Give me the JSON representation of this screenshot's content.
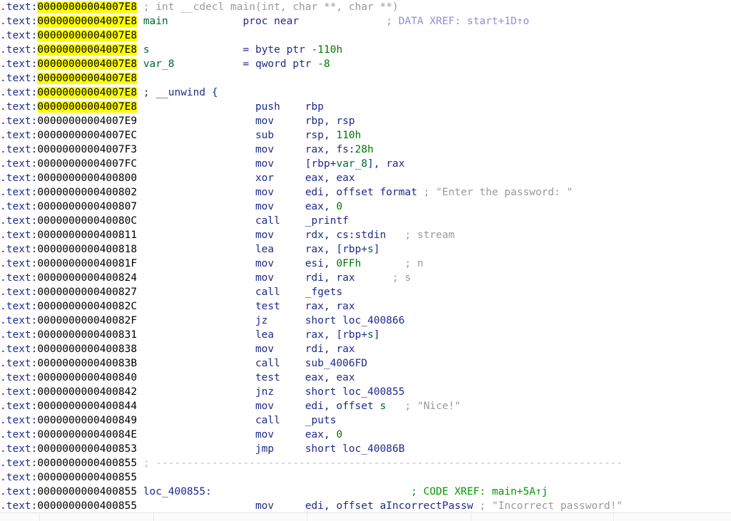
{
  "view": {
    "title": "IDA View-A",
    "segment": ".text",
    "highlight_color": "#ffff00",
    "background_color": "#ffffff"
  },
  "columns": {
    "segment_prefix": ".text:",
    "address_width_chars": 16
  },
  "lines": [
    {
      "seg": ".text:",
      "addr": "00000000004007E8",
      "hl": true,
      "body": [
        {
          "t": "gap",
          "v": " "
        },
        {
          "t": "cmt",
          "v": "; int __cdecl main(int, char **, char **)"
        }
      ]
    },
    {
      "seg": ".text:",
      "addr": "00000000004007E8",
      "hl": true,
      "body": [
        {
          "t": "gap",
          "v": " "
        },
        {
          "t": "name",
          "v": "main"
        },
        {
          "t": "gap",
          "v": "            "
        },
        {
          "t": "kw",
          "v": "proc near"
        },
        {
          "t": "gap",
          "v": "              "
        },
        {
          "t": "xref-d",
          "v": "; DATA XREF: start+1D↑o"
        }
      ]
    },
    {
      "seg": ".text:",
      "addr": "00000000004007E8",
      "hl": true,
      "body": []
    },
    {
      "seg": ".text:",
      "addr": "00000000004007E8",
      "hl": true,
      "body": [
        {
          "t": "gap",
          "v": " "
        },
        {
          "t": "name",
          "v": "s"
        },
        {
          "t": "gap",
          "v": "               "
        },
        {
          "t": "kw",
          "v": "= byte ptr "
        },
        {
          "t": "num",
          "v": "-110h"
        }
      ]
    },
    {
      "seg": ".text:",
      "addr": "00000000004007E8",
      "hl": true,
      "body": [
        {
          "t": "gap",
          "v": " "
        },
        {
          "t": "name",
          "v": "var_8"
        },
        {
          "t": "gap",
          "v": "           "
        },
        {
          "t": "kw",
          "v": "= qword ptr "
        },
        {
          "t": "num",
          "v": "-8"
        }
      ]
    },
    {
      "seg": ".text:",
      "addr": "00000000004007E8",
      "hl": true,
      "body": []
    },
    {
      "seg": ".text:",
      "addr": "00000000004007E8",
      "hl": true,
      "body": [
        {
          "t": "gap",
          "v": " "
        },
        {
          "t": "reg",
          "v": "; __unwind {"
        }
      ]
    },
    {
      "seg": ".text:",
      "addr": "00000000004007E8",
      "hl": true,
      "body": [
        {
          "t": "gap",
          "v": "                   "
        },
        {
          "t": "mnem",
          "v": "push"
        },
        {
          "t": "gap",
          "v": "    "
        },
        {
          "t": "reg",
          "v": "rbp"
        }
      ]
    },
    {
      "seg": ".text:",
      "addr": "00000000004007E9",
      "hl": false,
      "body": [
        {
          "t": "gap",
          "v": "                   "
        },
        {
          "t": "mnem",
          "v": "mov"
        },
        {
          "t": "gap",
          "v": "     "
        },
        {
          "t": "reg",
          "v": "rbp, rsp"
        }
      ]
    },
    {
      "seg": ".text:",
      "addr": "00000000004007EC",
      "hl": false,
      "body": [
        {
          "t": "gap",
          "v": "                   "
        },
        {
          "t": "mnem",
          "v": "sub"
        },
        {
          "t": "gap",
          "v": "     "
        },
        {
          "t": "reg",
          "v": "rsp, "
        },
        {
          "t": "num",
          "v": "110h"
        }
      ]
    },
    {
      "seg": ".text:",
      "addr": "00000000004007F3",
      "hl": false,
      "body": [
        {
          "t": "gap",
          "v": "                   "
        },
        {
          "t": "mnem",
          "v": "mov"
        },
        {
          "t": "gap",
          "v": "     "
        },
        {
          "t": "reg",
          "v": "rax, fs:"
        },
        {
          "t": "num",
          "v": "28h"
        }
      ]
    },
    {
      "seg": ".text:",
      "addr": "00000000004007FC",
      "hl": false,
      "body": [
        {
          "t": "gap",
          "v": "                   "
        },
        {
          "t": "mnem",
          "v": "mov"
        },
        {
          "t": "gap",
          "v": "     "
        },
        {
          "t": "reg",
          "v": "[rbp+"
        },
        {
          "t": "name",
          "v": "var_8"
        },
        {
          "t": "reg",
          "v": "], rax"
        }
      ]
    },
    {
      "seg": ".text:",
      "addr": "0000000000400800",
      "hl": false,
      "body": [
        {
          "t": "gap",
          "v": "                   "
        },
        {
          "t": "mnem",
          "v": "xor"
        },
        {
          "t": "gap",
          "v": "     "
        },
        {
          "t": "reg",
          "v": "eax, eax"
        }
      ]
    },
    {
      "seg": ".text:",
      "addr": "0000000000400802",
      "hl": false,
      "body": [
        {
          "t": "gap",
          "v": "                   "
        },
        {
          "t": "mnem",
          "v": "mov"
        },
        {
          "t": "gap",
          "v": "     "
        },
        {
          "t": "reg",
          "v": "edi, offset format"
        },
        {
          "t": "gap",
          "v": " "
        },
        {
          "t": "cmt",
          "v": "; \"Enter the password: \""
        }
      ]
    },
    {
      "seg": ".text:",
      "addr": "0000000000400807",
      "hl": false,
      "body": [
        {
          "t": "gap",
          "v": "                   "
        },
        {
          "t": "mnem",
          "v": "mov"
        },
        {
          "t": "gap",
          "v": "     "
        },
        {
          "t": "reg",
          "v": "eax, "
        },
        {
          "t": "num",
          "v": "0"
        }
      ]
    },
    {
      "seg": ".text:",
      "addr": "000000000040080C",
      "hl": false,
      "body": [
        {
          "t": "gap",
          "v": "                   "
        },
        {
          "t": "mnem",
          "v": "call"
        },
        {
          "t": "gap",
          "v": "    "
        },
        {
          "t": "func",
          "v": "_printf"
        }
      ]
    },
    {
      "seg": ".text:",
      "addr": "0000000000400811",
      "hl": false,
      "body": [
        {
          "t": "gap",
          "v": "                   "
        },
        {
          "t": "mnem",
          "v": "mov"
        },
        {
          "t": "gap",
          "v": "     "
        },
        {
          "t": "reg",
          "v": "rdx, cs:stdin"
        },
        {
          "t": "gap",
          "v": "   "
        },
        {
          "t": "cmt",
          "v": "; stream"
        }
      ]
    },
    {
      "seg": ".text:",
      "addr": "0000000000400818",
      "hl": false,
      "body": [
        {
          "t": "gap",
          "v": "                   "
        },
        {
          "t": "mnem",
          "v": "lea"
        },
        {
          "t": "gap",
          "v": "     "
        },
        {
          "t": "reg",
          "v": "rax, [rbp+"
        },
        {
          "t": "name",
          "v": "s"
        },
        {
          "t": "reg",
          "v": "]"
        }
      ]
    },
    {
      "seg": ".text:",
      "addr": "000000000040081F",
      "hl": false,
      "body": [
        {
          "t": "gap",
          "v": "                   "
        },
        {
          "t": "mnem",
          "v": "mov"
        },
        {
          "t": "gap",
          "v": "     "
        },
        {
          "t": "reg",
          "v": "esi, "
        },
        {
          "t": "num",
          "v": "0FFh"
        },
        {
          "t": "gap",
          "v": "       "
        },
        {
          "t": "cmt",
          "v": "; n"
        }
      ]
    },
    {
      "seg": ".text:",
      "addr": "0000000000400824",
      "hl": false,
      "body": [
        {
          "t": "gap",
          "v": "                   "
        },
        {
          "t": "mnem",
          "v": "mov"
        },
        {
          "t": "gap",
          "v": "     "
        },
        {
          "t": "reg",
          "v": "rdi, rax"
        },
        {
          "t": "gap",
          "v": "      "
        },
        {
          "t": "cmt",
          "v": "; s"
        }
      ]
    },
    {
      "seg": ".text:",
      "addr": "0000000000400827",
      "hl": false,
      "body": [
        {
          "t": "gap",
          "v": "                   "
        },
        {
          "t": "mnem",
          "v": "call"
        },
        {
          "t": "gap",
          "v": "    "
        },
        {
          "t": "func",
          "v": "_fgets"
        }
      ]
    },
    {
      "seg": ".text:",
      "addr": "000000000040082C",
      "hl": false,
      "body": [
        {
          "t": "gap",
          "v": "                   "
        },
        {
          "t": "mnem",
          "v": "test"
        },
        {
          "t": "gap",
          "v": "    "
        },
        {
          "t": "reg",
          "v": "rax, rax"
        }
      ]
    },
    {
      "seg": ".text:",
      "addr": "000000000040082F",
      "hl": false,
      "body": [
        {
          "t": "gap",
          "v": "                   "
        },
        {
          "t": "mnem",
          "v": "jz"
        },
        {
          "t": "gap",
          "v": "      "
        },
        {
          "t": "loc",
          "v": "short loc_400866"
        }
      ]
    },
    {
      "seg": ".text:",
      "addr": "0000000000400831",
      "hl": false,
      "body": [
        {
          "t": "gap",
          "v": "                   "
        },
        {
          "t": "mnem",
          "v": "lea"
        },
        {
          "t": "gap",
          "v": "     "
        },
        {
          "t": "reg",
          "v": "rax, [rbp+"
        },
        {
          "t": "name",
          "v": "s"
        },
        {
          "t": "reg",
          "v": "]"
        }
      ]
    },
    {
      "seg": ".text:",
      "addr": "0000000000400838",
      "hl": false,
      "body": [
        {
          "t": "gap",
          "v": "                   "
        },
        {
          "t": "mnem",
          "v": "mov"
        },
        {
          "t": "gap",
          "v": "     "
        },
        {
          "t": "reg",
          "v": "rdi, rax"
        }
      ]
    },
    {
      "seg": ".text:",
      "addr": "000000000040083B",
      "hl": false,
      "body": [
        {
          "t": "gap",
          "v": "                   "
        },
        {
          "t": "mnem",
          "v": "call"
        },
        {
          "t": "gap",
          "v": "    "
        },
        {
          "t": "func",
          "v": "sub_4006FD"
        }
      ]
    },
    {
      "seg": ".text:",
      "addr": "0000000000400840",
      "hl": false,
      "body": [
        {
          "t": "gap",
          "v": "                   "
        },
        {
          "t": "mnem",
          "v": "test"
        },
        {
          "t": "gap",
          "v": "    "
        },
        {
          "t": "reg",
          "v": "eax, eax"
        }
      ]
    },
    {
      "seg": ".text:",
      "addr": "0000000000400842",
      "hl": false,
      "body": [
        {
          "t": "gap",
          "v": "                   "
        },
        {
          "t": "mnem",
          "v": "jnz"
        },
        {
          "t": "gap",
          "v": "     "
        },
        {
          "t": "loc",
          "v": "short loc_400855"
        }
      ]
    },
    {
      "seg": ".text:",
      "addr": "0000000000400844",
      "hl": false,
      "body": [
        {
          "t": "gap",
          "v": "                   "
        },
        {
          "t": "mnem",
          "v": "mov"
        },
        {
          "t": "gap",
          "v": "     "
        },
        {
          "t": "reg",
          "v": "edi, offset "
        },
        {
          "t": "name",
          "v": "s"
        },
        {
          "t": "gap",
          "v": "   "
        },
        {
          "t": "cmt",
          "v": "; \"Nice!\""
        }
      ]
    },
    {
      "seg": ".text:",
      "addr": "0000000000400849",
      "hl": false,
      "body": [
        {
          "t": "gap",
          "v": "                   "
        },
        {
          "t": "mnem",
          "v": "call"
        },
        {
          "t": "gap",
          "v": "    "
        },
        {
          "t": "func",
          "v": "_puts"
        }
      ]
    },
    {
      "seg": ".text:",
      "addr": "000000000040084E",
      "hl": false,
      "body": [
        {
          "t": "gap",
          "v": "                   "
        },
        {
          "t": "mnem",
          "v": "mov"
        },
        {
          "t": "gap",
          "v": "     "
        },
        {
          "t": "reg",
          "v": "eax, "
        },
        {
          "t": "num",
          "v": "0"
        }
      ]
    },
    {
      "seg": ".text:",
      "addr": "0000000000400853",
      "hl": false,
      "body": [
        {
          "t": "gap",
          "v": "                   "
        },
        {
          "t": "mnem",
          "v": "jmp"
        },
        {
          "t": "gap",
          "v": "     "
        },
        {
          "t": "loc",
          "v": "short loc_40086B"
        }
      ]
    },
    {
      "seg": ".text:",
      "addr": "0000000000400855",
      "hl": false,
      "body": [
        {
          "t": "gap",
          "v": " "
        },
        {
          "t": "dash",
          "v": "; ---------------------------------------------------------------------------"
        }
      ]
    },
    {
      "seg": ".text:",
      "addr": "0000000000400855",
      "hl": false,
      "body": []
    },
    {
      "seg": ".text:",
      "addr": "0000000000400855",
      "hl": false,
      "body": [
        {
          "t": "gap",
          "v": " "
        },
        {
          "t": "loc",
          "v": "loc_400855:"
        },
        {
          "t": "gap",
          "v": "                                "
        },
        {
          "t": "xref-c",
          "v": "; CODE XREF: main+5A↑j"
        }
      ]
    },
    {
      "seg": ".text:",
      "addr": "0000000000400855",
      "hl": false,
      "body": [
        {
          "t": "gap",
          "v": "                   "
        },
        {
          "t": "mnem",
          "v": "mov"
        },
        {
          "t": "gap",
          "v": "     "
        },
        {
          "t": "reg",
          "v": "edi, offset aIncorrectPassw"
        },
        {
          "t": "gap",
          "v": " "
        },
        {
          "t": "cmt",
          "v": "; \"Incorrect password!\""
        }
      ]
    }
  ],
  "statusbar": {
    "dividers_x": [
      55,
      215,
      430,
      660,
      860
    ]
  }
}
